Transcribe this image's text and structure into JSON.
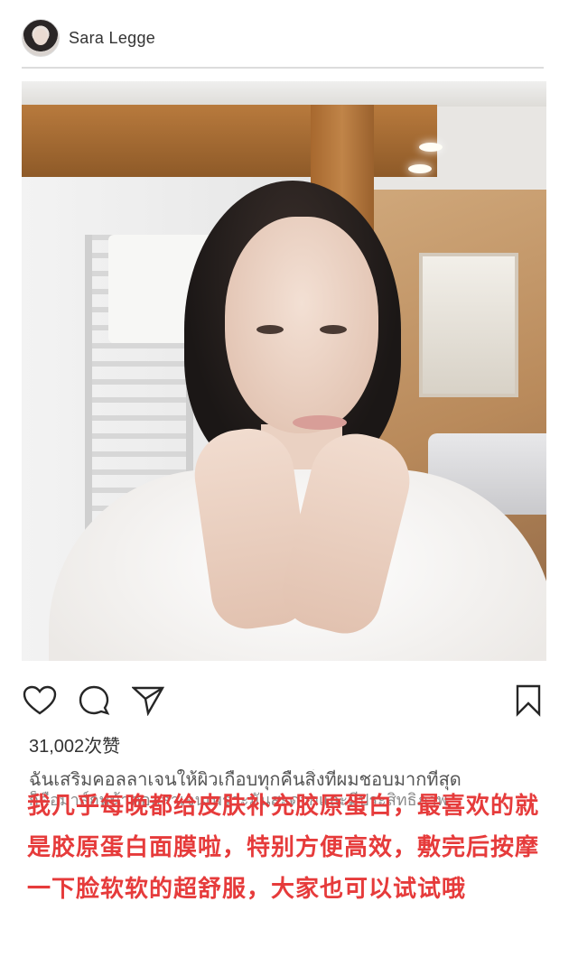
{
  "post": {
    "username": "Sara Legge",
    "likes_text": "31,002次赞",
    "caption_original_line1": "ฉันเสริมคอลลาเจนให้ผิวเกือบทุกคืนสิ่งที่ผมชอบมากที่สุด",
    "caption_original_line2": "ก็คือมาส์กหน้าคอลลาเจนเพราะมันสะดวกและมีประสิทธิภาพ",
    "caption_translation": "我几乎每晚都给皮肤补充胶原蛋白，最喜欢的就是胶原蛋白面膜啦，特别方便高效，敷完后按摩一下脸软软的超舒服，大家也可以试试哦"
  },
  "icons": {
    "avatar": "profile-photo",
    "like": "heart-icon",
    "comment": "comment-icon",
    "share": "send-icon",
    "save": "bookmark-icon"
  },
  "colors": {
    "caption_overlay": "#e63b3b",
    "text": "#262626",
    "divider": "#dcdcdc"
  }
}
